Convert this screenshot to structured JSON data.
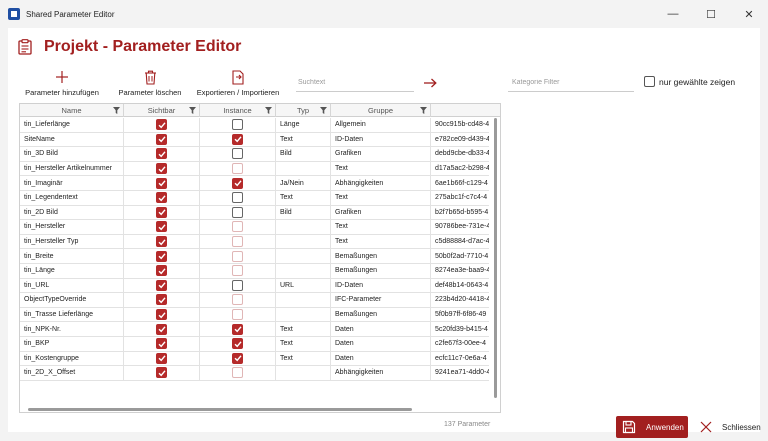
{
  "window": {
    "title": "Shared Parameter Editor",
    "minimize": "—",
    "maximize": "☐",
    "close": "✕"
  },
  "header": {
    "title": "Projekt - Parameter Editor"
  },
  "toolbar": {
    "add_label": "Parameter hinzufügen",
    "delete_label": "Parameter löschen",
    "export_label": "Exportieren / Importieren"
  },
  "search": {
    "placeholder": "Suchtext",
    "value": ""
  },
  "category_filter": {
    "placeholder": "Kategorie Filter",
    "value": ""
  },
  "only_selected": {
    "label": "nur gewählte zeigen",
    "checked": false
  },
  "columns": [
    "Name",
    "Sichtbar",
    "Instance",
    "Typ",
    "Gruppe"
  ],
  "rows": [
    {
      "name": "tin_Lieferlänge",
      "sichtbar": "checked",
      "instance": "unchecked",
      "typ": "Länge",
      "gruppe": "Allgemein",
      "id": "90cc915b-cd48-4"
    },
    {
      "name": "SiteName",
      "sichtbar": "checked",
      "instance": "checked",
      "typ": "Text",
      "gruppe": "ID-Daten",
      "id": "e782ce09-d439-4"
    },
    {
      "name": "tin_3D Bild",
      "sichtbar": "checked",
      "instance": "unchecked",
      "typ": "Bild",
      "gruppe": "Grafiken",
      "id": "debd9cbe-db33-4"
    },
    {
      "name": "tin_Hersteller Artikelnummer",
      "sichtbar": "checked",
      "instance": "disabled",
      "typ": "",
      "gruppe": "Text",
      "id": "d17a5ac2-b298-4"
    },
    {
      "name": "tin_Imaginär",
      "sichtbar": "checked",
      "instance": "checked",
      "typ": "Ja/Nein",
      "gruppe": "Abhängigkeiten",
      "id": "6ae1b66f-c129-4"
    },
    {
      "name": "tin_Legendentext",
      "sichtbar": "checked",
      "instance": "unchecked",
      "typ": "Text",
      "gruppe": "Text",
      "id": "275abc1f-c7c4-4"
    },
    {
      "name": "tin_2D Bild",
      "sichtbar": "checked",
      "instance": "unchecked",
      "typ": "Bild",
      "gruppe": "Grafiken",
      "id": "b2f7b65d-b595-4"
    },
    {
      "name": "tin_Hersteller",
      "sichtbar": "checked",
      "instance": "disabled",
      "typ": "",
      "gruppe": "Text",
      "id": "90786bee-731e-4"
    },
    {
      "name": "tin_Hersteller Typ",
      "sichtbar": "checked",
      "instance": "disabled",
      "typ": "",
      "gruppe": "Text",
      "id": "c5d88884-d7ac-4"
    },
    {
      "name": "tin_Breite",
      "sichtbar": "checked",
      "instance": "disabled",
      "typ": "",
      "gruppe": "Bemaßungen",
      "id": "50b0f2ad-7710-4"
    },
    {
      "name": "tin_Länge",
      "sichtbar": "checked",
      "instance": "disabled",
      "typ": "",
      "gruppe": "Bemaßungen",
      "id": "8274ea3e-baa9-4"
    },
    {
      "name": "tin_URL",
      "sichtbar": "checked",
      "instance": "unchecked",
      "typ": "URL",
      "gruppe": "ID-Daten",
      "id": "def48b14-0643-4"
    },
    {
      "name": "ObjectTypeOverride",
      "sichtbar": "checked",
      "instance": "disabled",
      "typ": "",
      "gruppe": "IFC-Parameter",
      "id": "223b4d20-4418-4"
    },
    {
      "name": "tin_Trasse Lieferlänge",
      "sichtbar": "checked",
      "instance": "disabled",
      "typ": "",
      "gruppe": "Bemaßungen",
      "id": "5f0b97ff-6f86-49"
    },
    {
      "name": "tin_NPK-Nr.",
      "sichtbar": "checked",
      "instance": "checked",
      "typ": "Text",
      "gruppe": "Daten",
      "id": "5c20fd39-b415-4"
    },
    {
      "name": "tin_BKP",
      "sichtbar": "checked",
      "instance": "checked",
      "typ": "Text",
      "gruppe": "Daten",
      "id": "c2fe67f3-00ee-4"
    },
    {
      "name": "tin_Kostengruppe",
      "sichtbar": "checked",
      "instance": "checked",
      "typ": "Text",
      "gruppe": "Daten",
      "id": "ecfc11c7-0e6a-4"
    },
    {
      "name": "tin_2D_X_Offset",
      "sichtbar": "checked",
      "instance": "disabled",
      "typ": "",
      "gruppe": "Abhängigkeiten",
      "id": "9241ea71-4dd0-4"
    }
  ],
  "count_label": "137 Parameter",
  "buttons": {
    "apply": "Anwenden",
    "close": "Schliessen"
  },
  "colors": {
    "accent": "#a21f1f",
    "checkbox_checked": "#b52a2a"
  }
}
